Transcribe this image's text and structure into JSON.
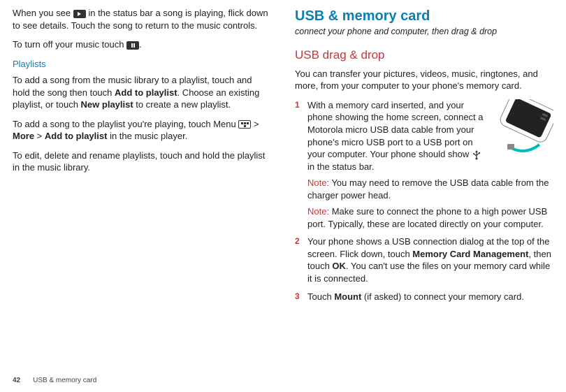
{
  "left": {
    "p1a": "When you see ",
    "p1b": " in the status bar a song is playing, flick down to see details. Touch the song to return to the music controls.",
    "p2a": "To turn off your music touch ",
    "p2b": ".",
    "playlistsHeading": "Playlists",
    "p3a": "To add a song from the music library to a playlist, touch and hold the song then touch ",
    "p3b": "Add to playlist",
    "p3c": ". Choose an existing playlist, or touch ",
    "p3d": "New playlist",
    "p3e": " to create a new playlist.",
    "p4a": "To add a song to the playlist you're playing, touch Menu ",
    "p4b": " > ",
    "p4c": "More",
    "p4d": " > ",
    "p4e": "Add to playlist",
    "p4f": " in the music player.",
    "p5": "To edit, delete and rename playlists, touch and hold the playlist in the music library."
  },
  "right": {
    "title": "USB & memory card",
    "subtitle": "connect your phone and computer, then drag & drop",
    "h2": "USB drag & drop",
    "intro": "You can transfer your pictures, videos, music, ringtones, and more, from your computer to your phone's memory card.",
    "step1a": "With a memory card inserted, and your phone showing the home screen, connect a Motorola micro USB data cable from your phone's micro USB port to a USB port on your computer. Your phone should show ",
    "step1b": " in the status bar.",
    "noteLabel": "Note:",
    "note1": " You may need to remove the USB data cable from the charger power head.",
    "note2": " Make sure to connect the phone to a high power USB port. Typically, these are located directly on your computer.",
    "step2a": "Your phone shows a USB connection dialog at the top of the screen. Flick down, touch ",
    "step2b": "Memory Card Management",
    "step2c": ", then touch ",
    "step2d": "OK",
    "step2e": ". You can't use the files on your memory card while it is connected.",
    "step3a": "Touch ",
    "step3b": "Mount",
    "step3c": " (if asked) to connect your memory card."
  },
  "footer": {
    "page": "42",
    "section": "USB & memory card"
  }
}
